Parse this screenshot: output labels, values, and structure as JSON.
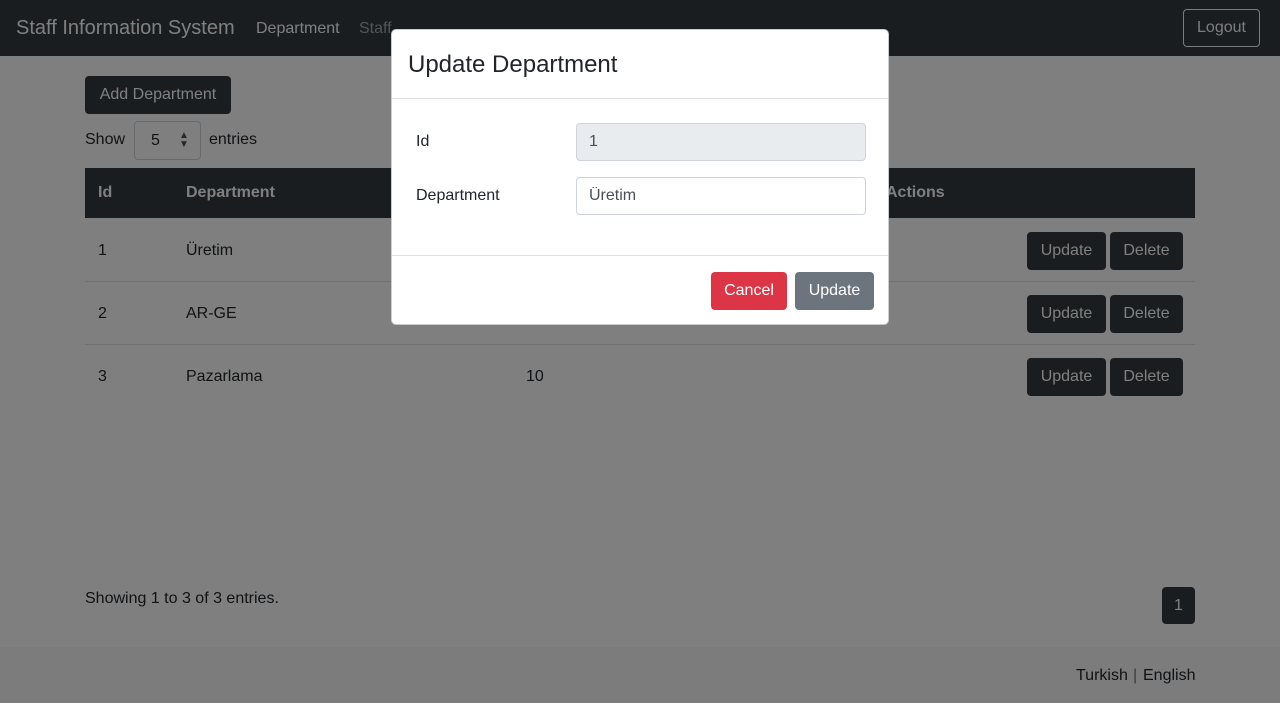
{
  "navbar": {
    "brand": "Staff Information System",
    "links": [
      "Department",
      "Staff"
    ],
    "logout": "Logout"
  },
  "toolbar": {
    "add_label": "Add Department",
    "show_label": "Show",
    "page_size": "5",
    "entries_label": "entries"
  },
  "table": {
    "headers": [
      "Id",
      "Department",
      "Actions"
    ],
    "rows": [
      {
        "id": "1",
        "department": "Üretim",
        "count": ""
      },
      {
        "id": "2",
        "department": "AR-GE",
        "count": ""
      },
      {
        "id": "3",
        "department": "Pazarlama",
        "count": "10"
      }
    ],
    "update_label": "Update",
    "delete_label": "Delete"
  },
  "pagination": {
    "summary": "Showing 1 to 3 of 3 entries.",
    "current_page": "1"
  },
  "footer": {
    "lang_tr": "Turkish",
    "separator": "|",
    "lang_en": "English"
  },
  "modal": {
    "title": "Update Department",
    "id_label": "Id",
    "id_value": "1",
    "department_label": "Department",
    "department_value": "Üretim",
    "cancel_label": "Cancel",
    "update_label": "Update"
  },
  "colors": {
    "navbar": "#343a40",
    "danger": "#dc3545",
    "secondary": "#6c757d"
  }
}
